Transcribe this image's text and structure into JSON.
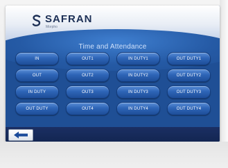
{
  "header": {
    "brand": "SAFRAN",
    "brand_sub": "Morpho",
    "logo_icon": "safran-logo-icon"
  },
  "screen": {
    "title": "Time and Attendance"
  },
  "buttons": [
    {
      "label": "IN"
    },
    {
      "label": "OUT1"
    },
    {
      "label": "IN DUTY1"
    },
    {
      "label": "OUT DUTY1"
    },
    {
      "label": "OUT"
    },
    {
      "label": "OUT2"
    },
    {
      "label": "IN DUTY2"
    },
    {
      "label": "OUT DUTY2"
    },
    {
      "label": "IN DUTY"
    },
    {
      "label": "OUT3"
    },
    {
      "label": "IN DUTY3"
    },
    {
      "label": "OUT DUTY3"
    },
    {
      "label": "OUT DUTY"
    },
    {
      "label": "OUT4"
    },
    {
      "label": "IN DUTY4"
    },
    {
      "label": "OUT DUTY4"
    }
  ],
  "footer": {
    "back_icon": "back-arrow-icon"
  },
  "colors": {
    "screen_bg": "#1f4f95",
    "button": "#2e65b7",
    "footer_bar": "#1b2f63",
    "arrow": "#1a4a9a"
  }
}
